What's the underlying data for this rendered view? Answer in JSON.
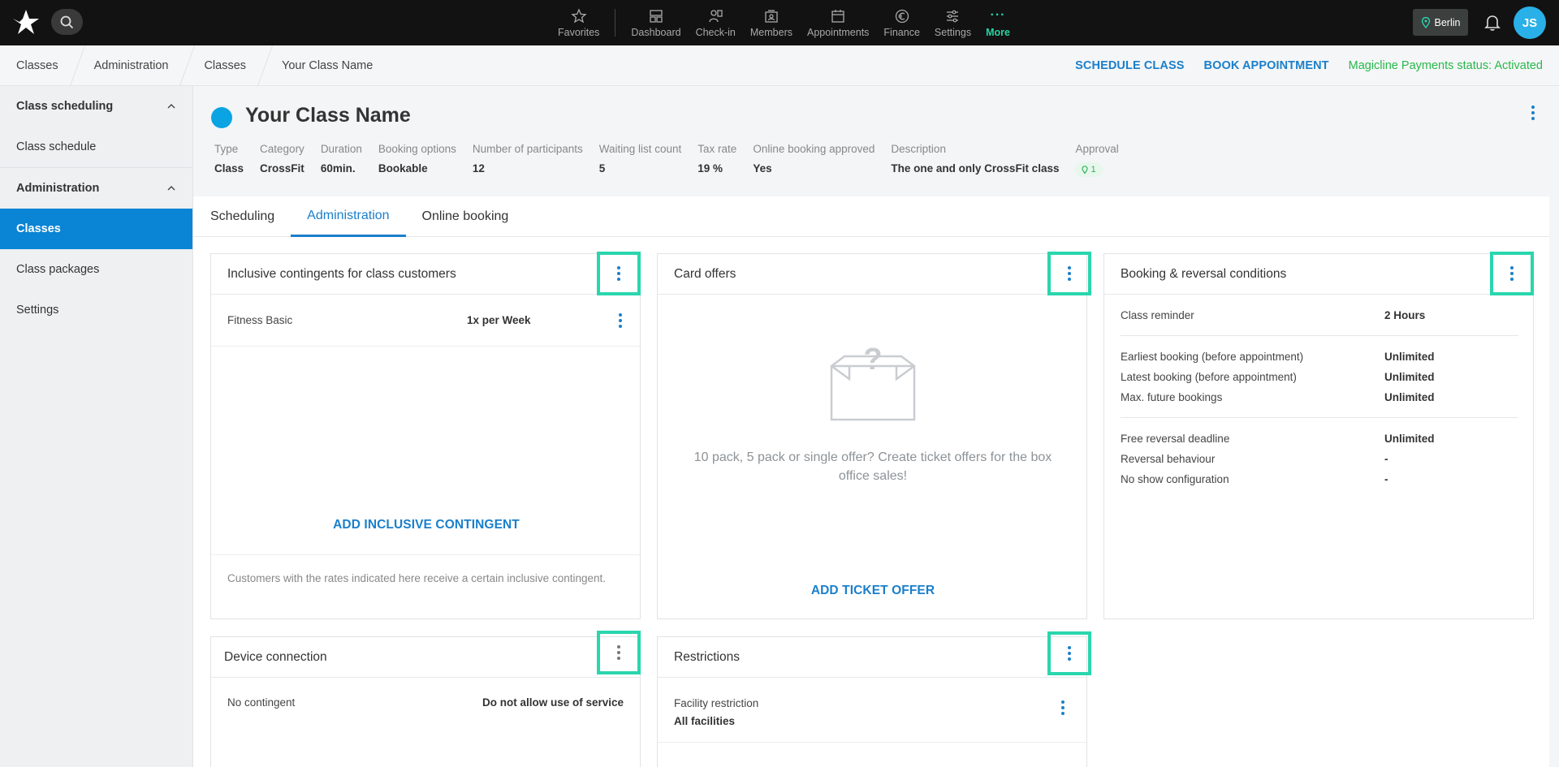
{
  "topnav": {
    "items": [
      {
        "label": "Favorites",
        "icon": "star-icon"
      },
      {
        "label": "Dashboard",
        "icon": "dashboard-icon"
      },
      {
        "label": "Check-in",
        "icon": "check-in-icon"
      },
      {
        "label": "Members",
        "icon": "members-icon"
      },
      {
        "label": "Appointments",
        "icon": "calendar-icon"
      },
      {
        "label": "Finance",
        "icon": "euro-icon"
      },
      {
        "label": "Settings",
        "icon": "sliders-icon"
      },
      {
        "label": "More",
        "icon": "more-dots-icon"
      }
    ],
    "location": "Berlin",
    "avatar_initials": "JS"
  },
  "breadcrumb": [
    "Classes",
    "Administration",
    "Classes",
    "Your Class Name"
  ],
  "header_actions": {
    "schedule": "SCHEDULE CLASS",
    "book": "BOOK APPOINTMENT",
    "payments_status": "Magicline Payments status: Activated"
  },
  "sidebar": {
    "groups": [
      {
        "label": "Class scheduling",
        "items": [
          "Class schedule"
        ]
      },
      {
        "label": "Administration",
        "items": [
          "Classes",
          "Class packages",
          "Settings"
        ]
      }
    ],
    "active_item": "Classes"
  },
  "class": {
    "title": "Your Class Name",
    "meta": [
      {
        "key": "Type",
        "value": "Class"
      },
      {
        "key": "Category",
        "value": "CrossFit"
      },
      {
        "key": "Duration",
        "value": "60min."
      },
      {
        "key": "Booking options",
        "value": "Bookable"
      },
      {
        "key": "Number of participants",
        "value": "12"
      },
      {
        "key": "Waiting list count",
        "value": "5"
      },
      {
        "key": "Tax rate",
        "value": "19 %"
      },
      {
        "key": "Online booking approved",
        "value": "Yes"
      },
      {
        "key": "Description",
        "value": "The one and only CrossFit class"
      },
      {
        "key": "Approval",
        "value": "1"
      }
    ]
  },
  "tabs": [
    "Scheduling",
    "Administration",
    "Online booking"
  ],
  "active_tab": "Administration",
  "cards": {
    "contingents": {
      "title": "Inclusive contingents for class customers",
      "row_name": "Fitness Basic",
      "row_value": "1x per Week",
      "add_label": "ADD INCLUSIVE CONTINGENT",
      "hint": "Customers with the rates indicated here receive a certain inclusive contingent."
    },
    "card_offers": {
      "title": "Card offers",
      "empty_text": "10 pack, 5 pack or single offer? Create ticket offers for the box office sales!",
      "add_label": "ADD TICKET OFFER"
    },
    "booking": {
      "title": "Booking & reversal conditions",
      "groups": [
        [
          {
            "k": "Class reminder",
            "v": "2 Hours"
          }
        ],
        [
          {
            "k": "Earliest booking (before appointment)",
            "v": "Unlimited"
          },
          {
            "k": "Latest booking (before appointment)",
            "v": "Unlimited"
          },
          {
            "k": "Max. future bookings",
            "v": "Unlimited"
          }
        ],
        [
          {
            "k": "Free reversal deadline",
            "v": "Unlimited"
          },
          {
            "k": "Reversal behaviour",
            "v": "-"
          },
          {
            "k": "No show configuration",
            "v": "-"
          }
        ]
      ]
    },
    "device": {
      "title": "Device connection",
      "row_name": "No contingent",
      "row_value": "Do not allow use of service"
    },
    "restrictions": {
      "title": "Restrictions",
      "row_name": "Facility restriction",
      "row_value": "All facilities"
    }
  },
  "colors": {
    "accent": "#1a7fcb",
    "highlight": "#2ad6ad",
    "status_green": "#27b84b",
    "class_dot": "#0aa4e3"
  }
}
